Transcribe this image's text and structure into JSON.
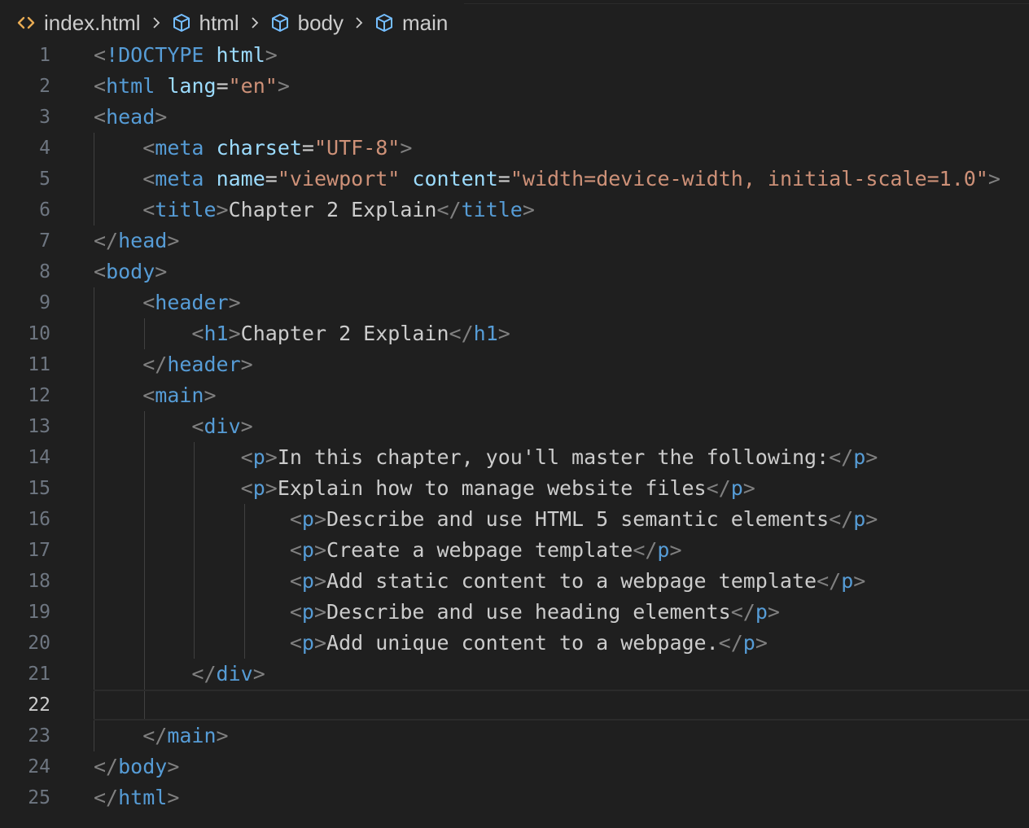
{
  "breadcrumb": {
    "file": "index.html",
    "items": [
      {
        "label": "html",
        "icon": "symbol-box-icon"
      },
      {
        "label": "body",
        "icon": "symbol-box-icon"
      },
      {
        "label": "main",
        "icon": "symbol-box-icon"
      }
    ]
  },
  "colors": {
    "tag": "#569cd6",
    "attribute": "#9cdcfe",
    "string": "#ce9178",
    "bracket": "#808080",
    "text": "#cccccc",
    "line_number": "#6e7681",
    "active_line_number": "#cccccc",
    "file_icon": "#e8ab53"
  },
  "editor": {
    "active_line": 22,
    "lines": [
      {
        "n": "1",
        "tokens": [
          [
            "br",
            "<"
          ],
          [
            "tg",
            "!DOCTYPE"
          ],
          [
            "tx",
            " "
          ],
          [
            "at",
            "html"
          ],
          [
            "br",
            ">"
          ]
        ]
      },
      {
        "n": "2",
        "tokens": [
          [
            "br",
            "<"
          ],
          [
            "tg",
            "html"
          ],
          [
            "tx",
            " "
          ],
          [
            "at",
            "lang"
          ],
          [
            "tx",
            "="
          ],
          [
            "st",
            "\"en\""
          ],
          [
            "br",
            ">"
          ]
        ]
      },
      {
        "n": "3",
        "tokens": [
          [
            "br",
            "<"
          ],
          [
            "tg",
            "head"
          ],
          [
            "br",
            ">"
          ]
        ]
      },
      {
        "n": "4",
        "tokens": [
          [
            "tx",
            "    "
          ],
          [
            "br",
            "<"
          ],
          [
            "tg",
            "meta"
          ],
          [
            "tx",
            " "
          ],
          [
            "at",
            "charset"
          ],
          [
            "tx",
            "="
          ],
          [
            "st",
            "\"UTF-8\""
          ],
          [
            "br",
            ">"
          ]
        ]
      },
      {
        "n": "5",
        "tokens": [
          [
            "tx",
            "    "
          ],
          [
            "br",
            "<"
          ],
          [
            "tg",
            "meta"
          ],
          [
            "tx",
            " "
          ],
          [
            "at",
            "name"
          ],
          [
            "tx",
            "="
          ],
          [
            "st",
            "\"viewport\""
          ],
          [
            "tx",
            " "
          ],
          [
            "at",
            "content"
          ],
          [
            "tx",
            "="
          ],
          [
            "st",
            "\"width=device-width, initial-scale=1.0\""
          ],
          [
            "br",
            ">"
          ]
        ]
      },
      {
        "n": "6",
        "tokens": [
          [
            "tx",
            "    "
          ],
          [
            "br",
            "<"
          ],
          [
            "tg",
            "title"
          ],
          [
            "br",
            ">"
          ],
          [
            "tx",
            "Chapter 2 Explain"
          ],
          [
            "br",
            "</"
          ],
          [
            "tg",
            "title"
          ],
          [
            "br",
            ">"
          ]
        ]
      },
      {
        "n": "7",
        "tokens": [
          [
            "br",
            "</"
          ],
          [
            "tg",
            "head"
          ],
          [
            "br",
            ">"
          ]
        ]
      },
      {
        "n": "8",
        "tokens": [
          [
            "br",
            "<"
          ],
          [
            "tg",
            "body"
          ],
          [
            "br",
            ">"
          ]
        ]
      },
      {
        "n": "9",
        "tokens": [
          [
            "tx",
            "    "
          ],
          [
            "br",
            "<"
          ],
          [
            "tg",
            "header"
          ],
          [
            "br",
            ">"
          ]
        ]
      },
      {
        "n": "10",
        "tokens": [
          [
            "tx",
            "        "
          ],
          [
            "br",
            "<"
          ],
          [
            "tg",
            "h1"
          ],
          [
            "br",
            ">"
          ],
          [
            "tx",
            "Chapter 2 Explain"
          ],
          [
            "br",
            "</"
          ],
          [
            "tg",
            "h1"
          ],
          [
            "br",
            ">"
          ]
        ]
      },
      {
        "n": "11",
        "tokens": [
          [
            "tx",
            "    "
          ],
          [
            "br",
            "</"
          ],
          [
            "tg",
            "header"
          ],
          [
            "br",
            ">"
          ]
        ]
      },
      {
        "n": "12",
        "tokens": [
          [
            "tx",
            "    "
          ],
          [
            "br",
            "<"
          ],
          [
            "tg",
            "main"
          ],
          [
            "br",
            ">"
          ]
        ]
      },
      {
        "n": "13",
        "tokens": [
          [
            "tx",
            "        "
          ],
          [
            "br",
            "<"
          ],
          [
            "tg",
            "div"
          ],
          [
            "br",
            ">"
          ]
        ]
      },
      {
        "n": "14",
        "tokens": [
          [
            "tx",
            "            "
          ],
          [
            "br",
            "<"
          ],
          [
            "tg",
            "p"
          ],
          [
            "br",
            ">"
          ],
          [
            "tx",
            "In this chapter, you'll master the following:"
          ],
          [
            "br",
            "</"
          ],
          [
            "tg",
            "p"
          ],
          [
            "br",
            ">"
          ]
        ]
      },
      {
        "n": "15",
        "tokens": [
          [
            "tx",
            "            "
          ],
          [
            "br",
            "<"
          ],
          [
            "tg",
            "p"
          ],
          [
            "br",
            ">"
          ],
          [
            "tx",
            "Explain how to manage website files"
          ],
          [
            "br",
            "</"
          ],
          [
            "tg",
            "p"
          ],
          [
            "br",
            ">"
          ]
        ]
      },
      {
        "n": "16",
        "tokens": [
          [
            "tx",
            "                "
          ],
          [
            "br",
            "<"
          ],
          [
            "tg",
            "p"
          ],
          [
            "br",
            ">"
          ],
          [
            "tx",
            "Describe and use HTML 5 semantic elements"
          ],
          [
            "br",
            "</"
          ],
          [
            "tg",
            "p"
          ],
          [
            "br",
            ">"
          ]
        ]
      },
      {
        "n": "17",
        "tokens": [
          [
            "tx",
            "                "
          ],
          [
            "br",
            "<"
          ],
          [
            "tg",
            "p"
          ],
          [
            "br",
            ">"
          ],
          [
            "tx",
            "Create a webpage template"
          ],
          [
            "br",
            "</"
          ],
          [
            "tg",
            "p"
          ],
          [
            "br",
            ">"
          ]
        ]
      },
      {
        "n": "18",
        "tokens": [
          [
            "tx",
            "                "
          ],
          [
            "br",
            "<"
          ],
          [
            "tg",
            "p"
          ],
          [
            "br",
            ">"
          ],
          [
            "tx",
            "Add static content to a webpage template"
          ],
          [
            "br",
            "</"
          ],
          [
            "tg",
            "p"
          ],
          [
            "br",
            ">"
          ]
        ]
      },
      {
        "n": "19",
        "tokens": [
          [
            "tx",
            "                "
          ],
          [
            "br",
            "<"
          ],
          [
            "tg",
            "p"
          ],
          [
            "br",
            ">"
          ],
          [
            "tx",
            "Describe and use heading elements"
          ],
          [
            "br",
            "</"
          ],
          [
            "tg",
            "p"
          ],
          [
            "br",
            ">"
          ]
        ]
      },
      {
        "n": "20",
        "tokens": [
          [
            "tx",
            "                "
          ],
          [
            "br",
            "<"
          ],
          [
            "tg",
            "p"
          ],
          [
            "br",
            ">"
          ],
          [
            "tx",
            "Add unique content to a webpage."
          ],
          [
            "br",
            "</"
          ],
          [
            "tg",
            "p"
          ],
          [
            "br",
            ">"
          ]
        ]
      },
      {
        "n": "21",
        "tokens": [
          [
            "tx",
            "        "
          ],
          [
            "br",
            "</"
          ],
          [
            "tg",
            "div"
          ],
          [
            "br",
            ">"
          ]
        ]
      },
      {
        "n": "22",
        "tokens": []
      },
      {
        "n": "23",
        "tokens": [
          [
            "tx",
            "    "
          ],
          [
            "br",
            "</"
          ],
          [
            "tg",
            "main"
          ],
          [
            "br",
            ">"
          ]
        ]
      },
      {
        "n": "24",
        "tokens": [
          [
            "br",
            "</"
          ],
          [
            "tg",
            "body"
          ],
          [
            "br",
            ">"
          ]
        ]
      },
      {
        "n": "25",
        "tokens": [
          [
            "br",
            "</"
          ],
          [
            "tg",
            "html"
          ],
          [
            "br",
            ">"
          ]
        ]
      }
    ]
  }
}
